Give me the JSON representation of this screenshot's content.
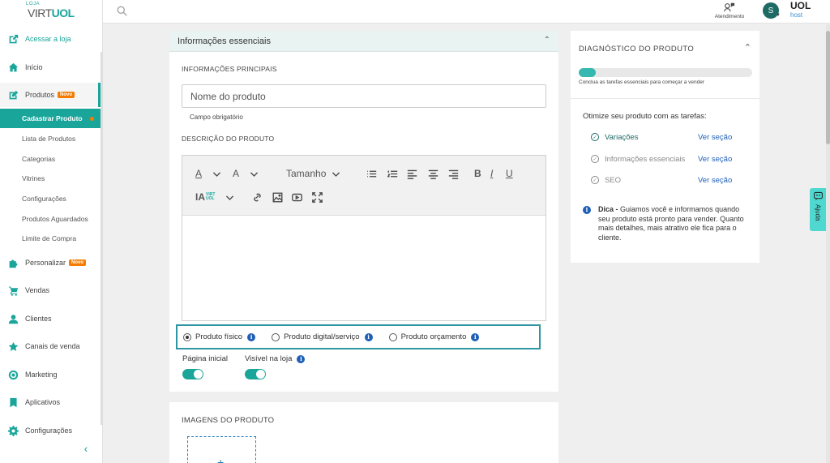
{
  "logo": {
    "small": "LOJA",
    "virt": "VIRT",
    "uol": "UOL"
  },
  "sidebar": {
    "top_link": "Acessar a loja",
    "items": [
      {
        "label": "Início",
        "icon": "home-icon"
      },
      {
        "label": "Produtos",
        "icon": "edit-icon",
        "badge": "Novo"
      },
      {
        "label": "Personalizar",
        "icon": "puzzle-icon",
        "badge": "Novo"
      },
      {
        "label": "Vendas",
        "icon": "cart-icon"
      },
      {
        "label": "Clientes",
        "icon": "person-icon"
      },
      {
        "label": "Canais de venda",
        "icon": "star-icon"
      },
      {
        "label": "Marketing",
        "icon": "target-icon"
      },
      {
        "label": "Aplicativos",
        "icon": "bookmark-icon"
      },
      {
        "label": "Configurações",
        "icon": "gear-icon"
      }
    ],
    "sub_items": [
      "Cadastrar Produto",
      "Lista de Produtos",
      "Categorias",
      "Vitrines",
      "Configurações",
      "Produtos Aguardados",
      "Limite de Compra"
    ]
  },
  "topbar": {
    "atendimento": "Atendimento",
    "avatar_letter": "S",
    "uol": "UOL",
    "host": "host"
  },
  "main": {
    "section_title": "Informações essenciais",
    "principais_label": "INFORMAÇÕES PRINCIPAIS",
    "name_placeholder": "Nome do produto",
    "required_text": "Campo obrigatório",
    "descricao_label": "DESCRIÇÃO DO PRODUTO",
    "toolbar": {
      "font_color": "A",
      "bg_color": "A",
      "size": "Tamanho",
      "ia_label": "IA",
      "ia_sub": "VIRT UOL"
    },
    "product_types": [
      {
        "label": "Produto físico",
        "selected": true
      },
      {
        "label": "Produto digital/serviço",
        "selected": false
      },
      {
        "label": "Produto orçamento",
        "selected": false
      }
    ],
    "toggles": [
      {
        "label": "Página inicial",
        "on": true
      },
      {
        "label": "Visível na loja",
        "on": true
      }
    ],
    "images_label": "IMAGENS DO PRODUTO",
    "add_symbol": "+"
  },
  "diagnostico": {
    "title": "DIAGNÓSTICO DO PRODUTO",
    "progress": 0.1,
    "progress_text": "Conclua as tarefas essenciais para começar a vender",
    "optimize": "Otimize seu produto com as tarefas:",
    "tasks": [
      {
        "name": "Variações",
        "link": "Ver seção",
        "done": true
      },
      {
        "name": "Informações essenciais",
        "link": "Ver seção",
        "done": false
      },
      {
        "name": "SEO",
        "link": "Ver seção",
        "done": false
      }
    ],
    "tip_bold": "Dica -",
    "tip_text": "Guiamos você e informamos quando seu produto está pronto para vender. Quanto mais detalhes, mais atrativo ele fica para o cliente."
  },
  "ajuda": "Ajuda",
  "colors": {
    "accent": "#1aa59b",
    "badge": "#f57c00",
    "link": "#1f5fb8"
  }
}
